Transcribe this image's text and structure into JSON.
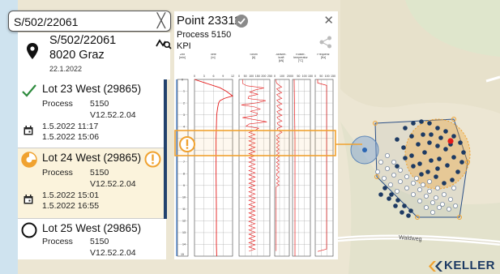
{
  "search": {
    "value": "S/502/22061",
    "clear_icon": "close-icon"
  },
  "location": {
    "id": "S/502/22061",
    "city": "8020 Graz",
    "date": "22.1.2022",
    "icons": [
      "location-pin-icon",
      "track-search-icon"
    ]
  },
  "lots": [
    {
      "title": "Lot 23 West (29865)",
      "process_label": "Process",
      "process_value": "5150",
      "version": "V12.52.2.04",
      "start": "1.5.2022 11:17",
      "end": "1.5.2022 15:06",
      "status": "complete",
      "status_icon": "checkmark-icon"
    },
    {
      "title": "Lot 24 West (29865)",
      "process_label": "Process",
      "process_value": "5150",
      "version": "V12.52.2.04",
      "start": "1.5.2022 15:01",
      "end": "1.5.2022 16:55",
      "status": "in-progress",
      "status_icon": "partial-circle-icon",
      "warning_icon": "warning-icon"
    },
    {
      "title": "Lot 25 West (29865)",
      "process_label": "Process",
      "process_value": "5150",
      "version": "V12.52.2.04",
      "status": "not-started",
      "status_icon": "empty-circle-icon"
    }
  ],
  "detail": {
    "title": "Point 23311",
    "process": "Process 5150",
    "kpi": "KPI",
    "close_icon": "close-icon",
    "share_icon": "share-icon",
    "verified_icon": "check-circle-icon",
    "columns": [
      {
        "name": "Zeit",
        "unit": "[min]"
      },
      {
        "name": "Tiefe",
        "unit": "[m]",
        "ticks": [
          "0",
          "3",
          "6",
          "9",
          "12"
        ]
      },
      {
        "name": "Strom",
        "unit": "[A]",
        "ticks": [
          "0",
          "50",
          "100",
          "150",
          "200",
          "250"
        ]
      },
      {
        "name": "Aktivier-kraft",
        "unit": "[kN]",
        "ticks": [
          "0",
          "100",
          "200"
        ]
      },
      {
        "name": "Rüttler-temperatur",
        "unit": "[°C]",
        "ticks": [
          "0",
          "50",
          "100",
          "150"
        ]
      },
      {
        "name": "Frequenz",
        "unit": "[Hz]",
        "ticks": [
          "0",
          "50",
          "100",
          "150"
        ]
      }
    ],
    "rows": [
      "0",
      "1",
      "2",
      "3",
      "4",
      "5",
      "6",
      "7",
      "8",
      "9",
      "10",
      "11",
      "12",
      "13",
      "14",
      "15"
    ],
    "warning_icon": "warning-icon"
  },
  "map": {
    "road_label": "Waldweg"
  },
  "logo": {
    "text": "KELLER"
  },
  "colors": {
    "accent": "#f0a230",
    "brand": "#1d3a63",
    "ok": "#2e8b3e",
    "highlight": "#e41b1b"
  }
}
